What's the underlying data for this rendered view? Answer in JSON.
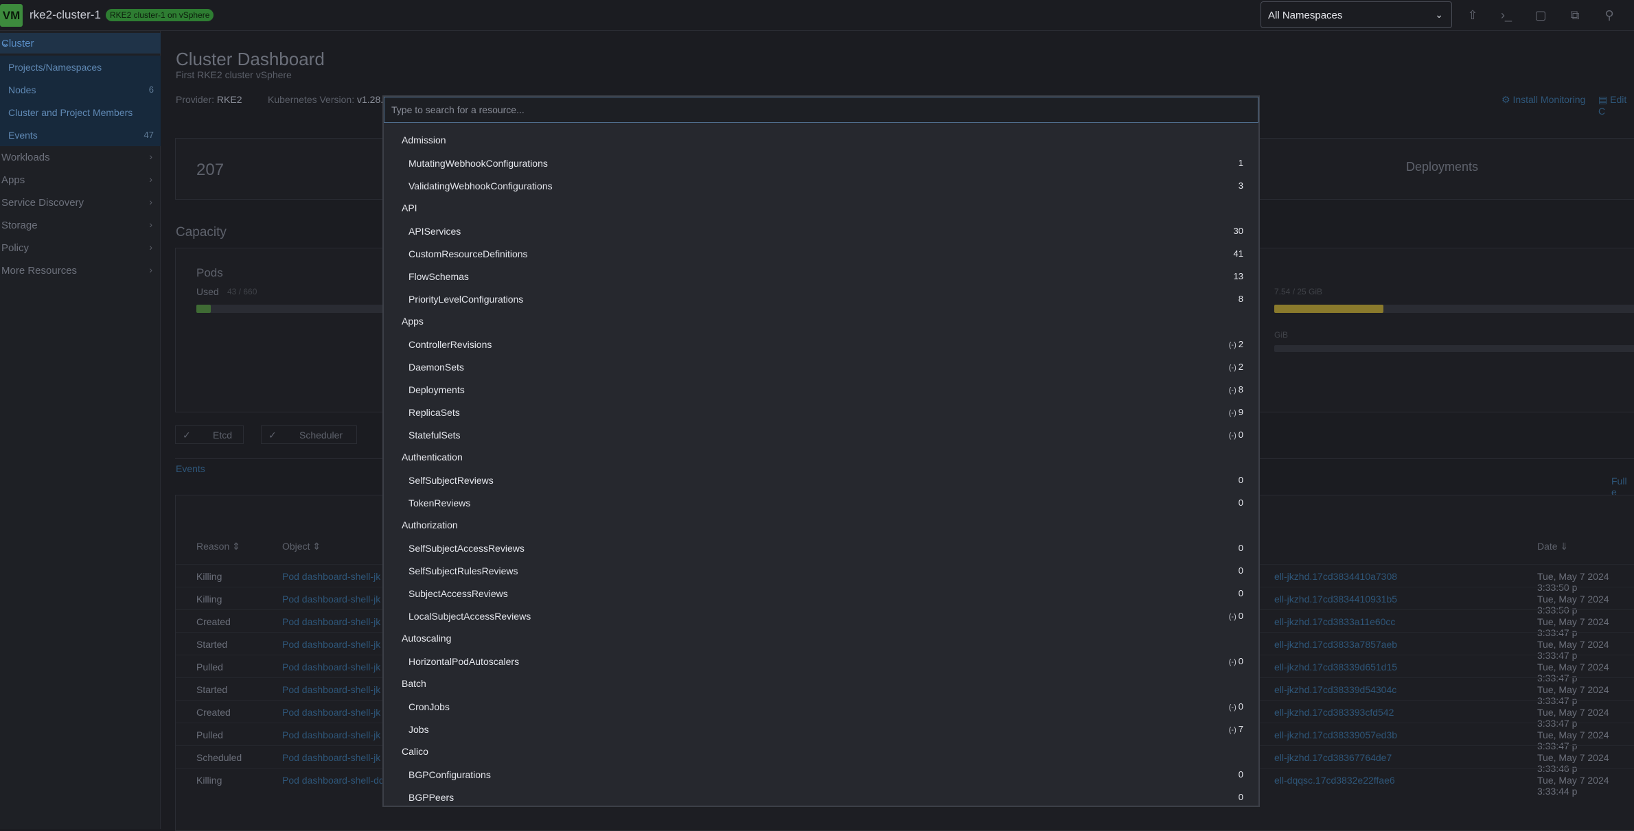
{
  "topbar": {
    "logo": "VM",
    "cluster_name": "rke2-cluster-1",
    "cluster_badge": "RKE2 cluster-1 on vSphere",
    "namespace_select": "All Namespaces",
    "icons": [
      "upload-icon",
      "terminal-icon",
      "file-icon",
      "copy-icon",
      "search-icon"
    ]
  },
  "sidebar": {
    "cluster_label": "Cluster",
    "sub_items": [
      {
        "label": "Projects/Namespaces",
        "count": ""
      },
      {
        "label": "Nodes",
        "count": "6"
      },
      {
        "label": "Cluster and Project Members",
        "count": ""
      },
      {
        "label": "Events",
        "count": "47"
      }
    ],
    "groups": [
      "Workloads",
      "Apps",
      "Service Discovery",
      "Storage",
      "Policy",
      "More Resources"
    ]
  },
  "main": {
    "title": "Cluster Dashboard",
    "subtitle": "First RKE2 cluster vSphere",
    "provider_label": "Provider:",
    "provider_value": "RKE2",
    "kubernetes_label": "Kubernetes Version:",
    "kubernetes_value": "v1.28.",
    "install_monitoring": "Install Monitoring",
    "edit": "Edit C",
    "stat_total": "207",
    "deployments_label": "Deployments",
    "capacity_label": "Capacity",
    "pods_label": "Pods",
    "pods_used_label": "Used",
    "pods_used_value": "43 / 660",
    "pods_used_fraction": 0.065,
    "memory_used_value": "7.54 / 25 GiB",
    "memory_used_fraction": 0.3,
    "mem_extra": "GiB",
    "components": [
      "Etcd",
      "Scheduler"
    ],
    "events_tab": "Events",
    "full_events": "Full e",
    "table_headers": {
      "reason": "Reason",
      "object": "Object",
      "date": "Date"
    },
    "events": [
      {
        "reason": "Killing",
        "object": "Pod dashboard-shell-jk",
        "name": "ell-jkzhd.17cd3834410a7308",
        "date": "Tue, May 7 2024  3:33:50 p"
      },
      {
        "reason": "Killing",
        "object": "Pod dashboard-shell-jk",
        "name": "ell-jkzhd.17cd3834410931b5",
        "date": "Tue, May 7 2024  3:33:50 p"
      },
      {
        "reason": "Created",
        "object": "Pod dashboard-shell-jk",
        "name": "ell-jkzhd.17cd3833a11e60cc",
        "date": "Tue, May 7 2024  3:33:47 p"
      },
      {
        "reason": "Started",
        "object": "Pod dashboard-shell-jk",
        "name": "ell-jkzhd.17cd3833a7857aeb",
        "date": "Tue, May 7 2024  3:33:47 p"
      },
      {
        "reason": "Pulled",
        "object": "Pod dashboard-shell-jk",
        "name": "ell-jkzhd.17cd38339d651d15",
        "date": "Tue, May 7 2024  3:33:47 p"
      },
      {
        "reason": "Started",
        "object": "Pod dashboard-shell-jk",
        "name": "ell-jkzhd.17cd38339d54304c",
        "date": "Tue, May 7 2024  3:33:47 p"
      },
      {
        "reason": "Created",
        "object": "Pod dashboard-shell-jk",
        "name": "ell-jkzhd.17cd383393cfd542",
        "date": "Tue, May 7 2024  3:33:47 p"
      },
      {
        "reason": "Pulled",
        "object": "Pod dashboard-shell-jk",
        "name": "ell-jkzhd.17cd38339057ed3b",
        "date": "Tue, May 7 2024  3:33:47 p"
      },
      {
        "reason": "Scheduled",
        "object": "Pod dashboard-shell-jk",
        "name": "ell-jkzhd.17cd38367764de7",
        "date": "Tue, May 7 2024  3:33:46 p"
      },
      {
        "reason": "Killing",
        "object": "Pod dashboard-shell-dq",
        "name": "ell-dqqsc.17cd3832e22ffae6",
        "date": "Tue, May 7 2024  3:33:44 p"
      }
    ]
  },
  "modal": {
    "search_placeholder": "Type to search for a resource...",
    "groups": [
      {
        "label": "Admission",
        "items": [
          {
            "name": "MutatingWebhookConfigurations",
            "count": "1",
            "ns": false
          },
          {
            "name": "ValidatingWebhookConfigurations",
            "count": "3",
            "ns": false
          }
        ]
      },
      {
        "label": "API",
        "items": [
          {
            "name": "APIServices",
            "count": "30",
            "ns": false
          },
          {
            "name": "CustomResourceDefinitions",
            "count": "41",
            "ns": false
          },
          {
            "name": "FlowSchemas",
            "count": "13",
            "ns": false
          },
          {
            "name": "PriorityLevelConfigurations",
            "count": "8",
            "ns": false
          }
        ]
      },
      {
        "label": "Apps",
        "items": [
          {
            "name": "ControllerRevisions",
            "count": "2",
            "ns": true
          },
          {
            "name": "DaemonSets",
            "count": "2",
            "ns": true
          },
          {
            "name": "Deployments",
            "count": "8",
            "ns": true
          },
          {
            "name": "ReplicaSets",
            "count": "9",
            "ns": true
          },
          {
            "name": "StatefulSets",
            "count": "0",
            "ns": true
          }
        ]
      },
      {
        "label": "Authentication",
        "items": [
          {
            "name": "SelfSubjectReviews",
            "count": "0",
            "ns": false
          },
          {
            "name": "TokenReviews",
            "count": "0",
            "ns": false
          }
        ]
      },
      {
        "label": "Authorization",
        "items": [
          {
            "name": "SelfSubjectAccessReviews",
            "count": "0",
            "ns": false
          },
          {
            "name": "SelfSubjectRulesReviews",
            "count": "0",
            "ns": false
          },
          {
            "name": "SubjectAccessReviews",
            "count": "0",
            "ns": false
          },
          {
            "name": "LocalSubjectAccessReviews",
            "count": "0",
            "ns": true
          }
        ]
      },
      {
        "label": "Autoscaling",
        "items": [
          {
            "name": "HorizontalPodAutoscalers",
            "count": "0",
            "ns": true
          }
        ]
      },
      {
        "label": "Batch",
        "items": [
          {
            "name": "CronJobs",
            "count": "0",
            "ns": true
          },
          {
            "name": "Jobs",
            "count": "7",
            "ns": true
          }
        ]
      },
      {
        "label": "Calico",
        "items": [
          {
            "name": "BGPConfigurations",
            "count": "0",
            "ns": false
          },
          {
            "name": "BGPPeers",
            "count": "0",
            "ns": false
          }
        ]
      }
    ]
  },
  "colors": {
    "accent": "#5b8fc7",
    "brand": "#3d8b3d",
    "pods_bar": "#4f8f3a",
    "memory_bar": "#b8a23a"
  }
}
